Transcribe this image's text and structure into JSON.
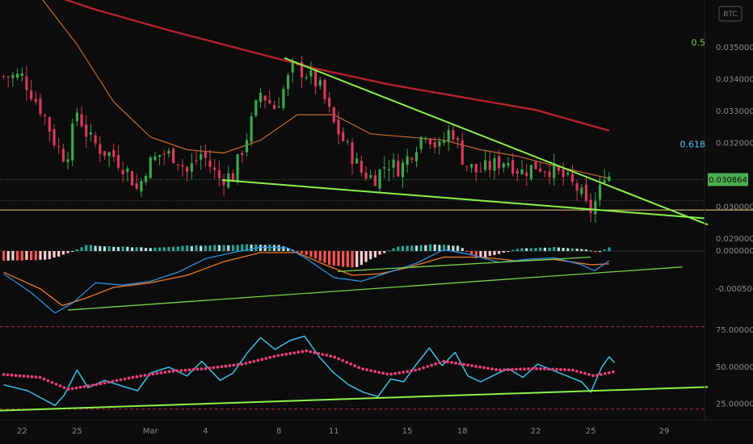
{
  "symbol_badge": "BTC",
  "fib_levels": [
    {
      "label": "0.5",
      "value": 0.03515,
      "color": "#7cd04c"
    },
    {
      "label": "0.618",
      "value": 0.03195,
      "color": "#4fc3f7"
    }
  ],
  "last_price": {
    "label": "0.030864",
    "value": 0.030864,
    "color": "#4caf50"
  },
  "x_axis": {
    "ticks": [
      {
        "label": "22",
        "day": 0
      },
      {
        "label": "25",
        "day": 3
      },
      {
        "label": "Mar",
        "day": 7
      },
      {
        "label": "4",
        "day": 10
      },
      {
        "label": "8",
        "day": 14
      },
      {
        "label": "11",
        "day": 17
      },
      {
        "label": "15",
        "day": 21
      },
      {
        "label": "18",
        "day": 24
      },
      {
        "label": "22",
        "day": 28
      },
      {
        "label": "25",
        "day": 31
      },
      {
        "label": "29",
        "day": 35
      }
    ]
  },
  "chart_data": [
    {
      "type": "candlestick",
      "panel": "price",
      "ylim": [
        0.0289,
        0.0365
      ],
      "y_ticks": [
        {
          "label": "0.035000",
          "value": 0.035
        },
        {
          "label": "0.034000",
          "value": 0.034
        },
        {
          "label": "0.033000",
          "value": 0.033
        },
        {
          "label": "0.032000",
          "value": 0.032
        },
        {
          "label": "0.030000",
          "value": 0.03
        },
        {
          "label": "0.029000",
          "value": 0.029
        }
      ],
      "xlim_days": [
        -1.2,
        37.2
      ],
      "anchors": [
        {
          "day": 0,
          "close": 0.0341
        },
        {
          "day": 0.4,
          "close": 0.0337
        },
        {
          "day": 1.2,
          "close": 0.0329
        },
        {
          "day": 1.8,
          "close": 0.032
        },
        {
          "day": 2.4,
          "close": 0.0315
        },
        {
          "day": 3,
          "close": 0.033
        },
        {
          "day": 3.6,
          "close": 0.0322
        },
        {
          "day": 4.3,
          "close": 0.0318
        },
        {
          "day": 5,
          "close": 0.0316
        },
        {
          "day": 5.8,
          "close": 0.0311
        },
        {
          "day": 6.3,
          "close": 0.0305
        },
        {
          "day": 6.8,
          "close": 0.0313
        },
        {
          "day": 7.6,
          "close": 0.0317
        },
        {
          "day": 8.4,
          "close": 0.0316
        },
        {
          "day": 9.0,
          "close": 0.0311
        },
        {
          "day": 9.8,
          "close": 0.0317
        },
        {
          "day": 10.7,
          "close": 0.0309
        },
        {
          "day": 11.5,
          "close": 0.031
        },
        {
          "day": 12.3,
          "close": 0.0323
        },
        {
          "day": 13.0,
          "close": 0.0336
        },
        {
          "day": 13.8,
          "close": 0.0331
        },
        {
          "day": 14.8,
          "close": 0.0344
        },
        {
          "day": 15.5,
          "close": 0.0342
        },
        {
          "day": 16.2,
          "close": 0.0338
        },
        {
          "day": 17.0,
          "close": 0.0326
        },
        {
          "day": 17.8,
          "close": 0.0318
        },
        {
          "day": 18.5,
          "close": 0.0311
        },
        {
          "day": 19.2,
          "close": 0.0309
        },
        {
          "day": 19.9,
          "close": 0.0314
        },
        {
          "day": 20.6,
          "close": 0.0312
        },
        {
          "day": 21.3,
          "close": 0.0318
        },
        {
          "day": 22.0,
          "close": 0.0324
        },
        {
          "day": 22.7,
          "close": 0.0318
        },
        {
          "day": 23.4,
          "close": 0.0325
        },
        {
          "day": 24.1,
          "close": 0.0314
        },
        {
          "day": 24.8,
          "close": 0.0311
        },
        {
          "day": 25.6,
          "close": 0.0313
        },
        {
          "day": 26.4,
          "close": 0.0315
        },
        {
          "day": 27.2,
          "close": 0.0311
        },
        {
          "day": 28.0,
          "close": 0.0313
        },
        {
          "day": 28.8,
          "close": 0.0312
        },
        {
          "day": 29.6,
          "close": 0.0309
        },
        {
          "day": 30.4,
          "close": 0.0305
        },
        {
          "day": 30.9,
          "close": 0.0298
        },
        {
          "day": 31.4,
          "close": 0.0303
        },
        {
          "day": 31.8,
          "close": 0.0312
        },
        {
          "day": 32.1,
          "close": 0.030864
        }
      ],
      "ma_slow": [
        {
          "day": -1,
          "value": 0.03715
        },
        {
          "day": 4,
          "value": 0.0362
        },
        {
          "day": 8,
          "value": 0.03555
        },
        {
          "day": 12,
          "value": 0.03495
        },
        {
          "day": 16,
          "value": 0.03435
        },
        {
          "day": 20,
          "value": 0.03385
        },
        {
          "day": 24,
          "value": 0.03345
        },
        {
          "day": 28,
          "value": 0.03305
        },
        {
          "day": 32,
          "value": 0.0324
        }
      ],
      "ma_fast": [
        {
          "day": -1,
          "value": 0.0376
        },
        {
          "day": 1,
          "value": 0.0366
        },
        {
          "day": 3,
          "value": 0.0351
        },
        {
          "day": 5,
          "value": 0.0333
        },
        {
          "day": 7,
          "value": 0.0322
        },
        {
          "day": 9,
          "value": 0.0318
        },
        {
          "day": 11,
          "value": 0.0317
        },
        {
          "day": 13,
          "value": 0.0321
        },
        {
          "day": 15,
          "value": 0.0329
        },
        {
          "day": 17,
          "value": 0.0329
        },
        {
          "day": 19,
          "value": 0.0323
        },
        {
          "day": 21,
          "value": 0.0322
        },
        {
          "day": 23,
          "value": 0.0321
        },
        {
          "day": 25,
          "value": 0.0318
        },
        {
          "day": 27,
          "value": 0.0316
        },
        {
          "day": 29,
          "value": 0.0313
        },
        {
          "day": 32,
          "value": 0.0309
        }
      ],
      "trendlines": [
        {
          "from": {
            "day": 14.3,
            "value": 0.03468
          },
          "to": {
            "day": 37.2,
            "value": 0.02945
          },
          "color": "#8cf04a"
        },
        {
          "from": {
            "day": 10.9,
            "value": 0.03085
          },
          "to": {
            "day": 37.0,
            "value": 0.02965
          },
          "color": "#8cf04a"
        }
      ],
      "horizontal_levels": [
        {
          "value": 0.02991,
          "color": "#e8d27a"
        }
      ]
    },
    {
      "type": "macd",
      "panel": "macd",
      "ylim": [
        -0.00095,
        0.00016
      ],
      "y_ticks": [
        {
          "label": "0.000000",
          "value": 0.0
        },
        {
          "label": "-0.000500",
          "value": -0.0005
        }
      ],
      "histogram": [
        {
          "day": -1.0,
          "value": -0.00013
        },
        {
          "day": 1.5,
          "value": -0.00011
        },
        {
          "day": 2.6,
          "value": -2e-05
        },
        {
          "day": 3.5,
          "value": 8e-05
        },
        {
          "day": 5.0,
          "value": 6e-05
        },
        {
          "day": 7.0,
          "value": 4e-05
        },
        {
          "day": 9.0,
          "value": 7e-05
        },
        {
          "day": 11.0,
          "value": 8e-05
        },
        {
          "day": 12.5,
          "value": 9e-05
        },
        {
          "day": 14.0,
          "value": 8e-05
        },
        {
          "day": 15.5,
          "value": -5e-05
        },
        {
          "day": 16.8,
          "value": -0.00019
        },
        {
          "day": 18.2,
          "value": -0.00022
        },
        {
          "day": 19.4,
          "value": -6e-05
        },
        {
          "day": 20.5,
          "value": 6e-05
        },
        {
          "day": 22.5,
          "value": 9e-05
        },
        {
          "day": 23.8,
          "value": 7e-05
        },
        {
          "day": 24.8,
          "value": -0.0001
        },
        {
          "day": 26.0,
          "value": -4e-05
        },
        {
          "day": 27.2,
          "value": 4e-05
        },
        {
          "day": 29.0,
          "value": 5e-05
        },
        {
          "day": 30.6,
          "value": 3e-05
        },
        {
          "day": 31.4,
          "value": -2e-05
        },
        {
          "day": 32.0,
          "value": 5e-05
        }
      ],
      "macd_line": [
        {
          "day": -1,
          "value": -0.0003
        },
        {
          "day": 0.5,
          "value": -0.00055
        },
        {
          "day": 1.8,
          "value": -0.00082
        },
        {
          "day": 2.8,
          "value": -0.00068
        },
        {
          "day": 4.0,
          "value": -0.00042
        },
        {
          "day": 5.5,
          "value": -0.00045
        },
        {
          "day": 7.0,
          "value": -0.0004
        },
        {
          "day": 8.5,
          "value": -0.00028
        },
        {
          "day": 10.0,
          "value": -0.0001
        },
        {
          "day": 11.5,
          "value": -2e-05
        },
        {
          "day": 13.0,
          "value": 5e-05
        },
        {
          "day": 14.5,
          "value": 4e-05
        },
        {
          "day": 15.5,
          "value": -0.0001
        },
        {
          "day": 17.0,
          "value": -0.00035
        },
        {
          "day": 18.5,
          "value": -0.0004
        },
        {
          "day": 20.0,
          "value": -0.00028
        },
        {
          "day": 21.5,
          "value": -0.00016
        },
        {
          "day": 23.0,
          "value": 2e-05
        },
        {
          "day": 24.5,
          "value": -5e-05
        },
        {
          "day": 26.0,
          "value": -0.00015
        },
        {
          "day": 27.5,
          "value": -0.00011
        },
        {
          "day": 29.0,
          "value": -9e-05
        },
        {
          "day": 30.5,
          "value": -0.00018
        },
        {
          "day": 31.2,
          "value": -0.00026
        },
        {
          "day": 32.0,
          "value": -0.00013
        }
      ],
      "signal_line": [
        {
          "day": -1,
          "value": -0.00028
        },
        {
          "day": 1.0,
          "value": -0.0005
        },
        {
          "day": 2.2,
          "value": -0.00072
        },
        {
          "day": 3.5,
          "value": -0.00062
        },
        {
          "day": 5.0,
          "value": -0.00048
        },
        {
          "day": 7.0,
          "value": -0.00042
        },
        {
          "day": 9.0,
          "value": -0.00032
        },
        {
          "day": 11.0,
          "value": -0.00014
        },
        {
          "day": 13.0,
          "value": -2e-05
        },
        {
          "day": 15.0,
          "value": -2e-05
        },
        {
          "day": 16.5,
          "value": -0.00018
        },
        {
          "day": 18.0,
          "value": -0.00032
        },
        {
          "day": 19.5,
          "value": -0.0003
        },
        {
          "day": 21.0,
          "value": -0.00022
        },
        {
          "day": 23.0,
          "value": -8e-05
        },
        {
          "day": 25.0,
          "value": -8e-05
        },
        {
          "day": 27.0,
          "value": -0.00013
        },
        {
          "day": 29.0,
          "value": -0.00011
        },
        {
          "day": 31.0,
          "value": -0.00018
        },
        {
          "day": 32.0,
          "value": -0.00017
        }
      ],
      "trendlines": [
        {
          "from": {
            "day": 2.5,
            "value": -0.00078
          },
          "to": {
            "day": 36.0,
            "value": -0.00021
          },
          "color": "#7cd04c"
        },
        {
          "from": {
            "day": 17.2,
            "value": -0.00027
          },
          "to": {
            "day": 31.0,
            "value": -8e-05
          },
          "color": "#7cd04c"
        }
      ]
    },
    {
      "type": "rsi",
      "panel": "rsi",
      "ylim": [
        17,
        80
      ],
      "y_ticks": [
        {
          "label": "75.000000",
          "value": 75
        },
        {
          "label": "50.000000",
          "value": 50
        },
        {
          "label": "25.000000",
          "value": 25
        }
      ],
      "bands": [
        {
          "value": 77.5,
          "color": "#b03040"
        },
        {
          "value": 21.5,
          "color": "#b03040"
        }
      ],
      "rsi_line": [
        {
          "day": -1,
          "value": 38
        },
        {
          "day": 0.3,
          "value": 34
        },
        {
          "day": 1.2,
          "value": 28
        },
        {
          "day": 1.8,
          "value": 24
        },
        {
          "day": 2.3,
          "value": 31
        },
        {
          "day": 3.0,
          "value": 48
        },
        {
          "day": 3.6,
          "value": 36
        },
        {
          "day": 4.5,
          "value": 41
        },
        {
          "day": 5.5,
          "value": 37
        },
        {
          "day": 6.3,
          "value": 34
        },
        {
          "day": 7.0,
          "value": 46
        },
        {
          "day": 8.0,
          "value": 50
        },
        {
          "day": 9.0,
          "value": 44
        },
        {
          "day": 9.8,
          "value": 54
        },
        {
          "day": 10.8,
          "value": 41
        },
        {
          "day": 11.5,
          "value": 46
        },
        {
          "day": 12.3,
          "value": 60
        },
        {
          "day": 13.0,
          "value": 70
        },
        {
          "day": 13.8,
          "value": 62
        },
        {
          "day": 14.6,
          "value": 68
        },
        {
          "day": 15.4,
          "value": 71
        },
        {
          "day": 16.2,
          "value": 57
        },
        {
          "day": 17.0,
          "value": 46
        },
        {
          "day": 17.8,
          "value": 38
        },
        {
          "day": 18.6,
          "value": 33
        },
        {
          "day": 19.4,
          "value": 30
        },
        {
          "day": 20.1,
          "value": 42
        },
        {
          "day": 20.8,
          "value": 40
        },
        {
          "day": 21.5,
          "value": 52
        },
        {
          "day": 22.2,
          "value": 63
        },
        {
          "day": 22.9,
          "value": 51
        },
        {
          "day": 23.6,
          "value": 60
        },
        {
          "day": 24.3,
          "value": 44
        },
        {
          "day": 25.0,
          "value": 40
        },
        {
          "day": 25.8,
          "value": 45
        },
        {
          "day": 26.5,
          "value": 49
        },
        {
          "day": 27.3,
          "value": 43
        },
        {
          "day": 28.1,
          "value": 52
        },
        {
          "day": 28.9,
          "value": 48
        },
        {
          "day": 29.7,
          "value": 44
        },
        {
          "day": 30.5,
          "value": 40
        },
        {
          "day": 31.0,
          "value": 33
        },
        {
          "day": 31.6,
          "value": 50
        },
        {
          "day": 32.0,
          "value": 57
        },
        {
          "day": 32.3,
          "value": 53
        }
      ],
      "rsi_ma": [
        {
          "day": -1,
          "value": 45
        },
        {
          "day": 1.0,
          "value": 43
        },
        {
          "day": 2.5,
          "value": 35
        },
        {
          "day": 4.0,
          "value": 38
        },
        {
          "day": 6.0,
          "value": 43
        },
        {
          "day": 8.0,
          "value": 47
        },
        {
          "day": 10.0,
          "value": 49
        },
        {
          "day": 12.0,
          "value": 52
        },
        {
          "day": 14.0,
          "value": 58
        },
        {
          "day": 15.5,
          "value": 61
        },
        {
          "day": 17.0,
          "value": 57
        },
        {
          "day": 18.5,
          "value": 49
        },
        {
          "day": 20.0,
          "value": 45
        },
        {
          "day": 21.5,
          "value": 48
        },
        {
          "day": 23.0,
          "value": 54
        },
        {
          "day": 24.5,
          "value": 51
        },
        {
          "day": 26.0,
          "value": 48
        },
        {
          "day": 28.0,
          "value": 49
        },
        {
          "day": 30.0,
          "value": 48
        },
        {
          "day": 31.2,
          "value": 44
        },
        {
          "day": 32.3,
          "value": 47
        }
      ],
      "trendlines": [
        {
          "from": {
            "day": -1.2,
            "value": 20.5
          },
          "to": {
            "day": 37.2,
            "value": 36.5
          },
          "color": "#8cf04a"
        }
      ]
    }
  ]
}
